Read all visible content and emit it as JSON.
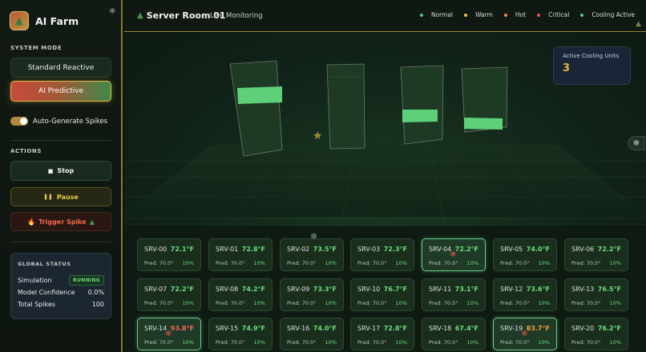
{
  "brand": {
    "name": "AI Farm",
    "logo_icon": "tree-icon"
  },
  "sidebar": {
    "system_mode_label": "SYSTEM MODE",
    "standard_label": "Standard Reactive",
    "ai_label": "AI Predictive",
    "toggle_label": "Auto-Generate Spikes",
    "toggle_on": true,
    "actions_label": "ACTIONS",
    "stop_label": "Stop",
    "pause_label": "Pause",
    "spike_label": "Trigger Spike",
    "global_status": {
      "title": "GLOBAL STATUS",
      "simulation_label": "Simulation",
      "simulation_value": "RUNNING",
      "confidence_label": "Model Confidence",
      "confidence_value": "0.0%",
      "spikes_label": "Total Spikes",
      "spikes_value": "100"
    }
  },
  "header": {
    "title": "Server Room 01",
    "subtitle": "Live Monitoring",
    "legend": [
      {
        "label": "Normal",
        "color": "#4fd07a"
      },
      {
        "label": "Warm",
        "color": "#f0c040"
      },
      {
        "label": "Hot",
        "color": "#f08a3a"
      },
      {
        "label": "Critical",
        "color": "#e85a4a"
      },
      {
        "label": "Cooling Active",
        "color": "#4fd07a"
      }
    ]
  },
  "scene": {
    "cooling_label": "Active Cooling Units",
    "cooling_value": "3"
  },
  "colors": {
    "normal": "#6ddc7a",
    "warm": "#e6e64a",
    "hot": "#f0a040",
    "critical": "#f06a5a",
    "accent": "#e0b84a"
  },
  "servers": [
    {
      "name": "SRV-00",
      "temp": "72.1°F",
      "pred": "Pred: 70.0°",
      "conf": "10%",
      "status": "normal"
    },
    {
      "name": "SRV-01",
      "temp": "72.8°F",
      "pred": "Pred: 70.0°",
      "conf": "10%",
      "status": "normal"
    },
    {
      "name": "SRV-02",
      "temp": "73.5°F",
      "pred": "Pred: 70.0°",
      "conf": "10%",
      "status": "normal"
    },
    {
      "name": "SRV-03",
      "temp": "72.3°F",
      "pred": "Pred: 70.0°",
      "conf": "10%",
      "status": "normal"
    },
    {
      "name": "SRV-04",
      "temp": "72.2°F",
      "pred": "Pred: 70.0°",
      "conf": "10%",
      "status": "normal",
      "highlight": true,
      "cooling": true
    },
    {
      "name": "SRV-05",
      "temp": "74.0°F",
      "pred": "Pred: 70.0°",
      "conf": "10%",
      "status": "normal"
    },
    {
      "name": "SRV-06",
      "temp": "72.2°F",
      "pred": "Pred: 70.0°",
      "conf": "10%",
      "status": "normal"
    },
    {
      "name": "SRV-07",
      "temp": "72.2°F",
      "pred": "Pred: 70.0°",
      "conf": "10%",
      "status": "normal"
    },
    {
      "name": "SRV-08",
      "temp": "74.2°F",
      "pred": "Pred: 70.0°",
      "conf": "10%",
      "status": "normal"
    },
    {
      "name": "SRV-09",
      "temp": "73.3°F",
      "pred": "Pred: 70.0°",
      "conf": "10%",
      "status": "normal"
    },
    {
      "name": "SRV-10",
      "temp": "76.7°F",
      "pred": "Pred: 70.0°",
      "conf": "10%",
      "status": "normal"
    },
    {
      "name": "SRV-11",
      "temp": "73.1°F",
      "pred": "Pred: 70.0°",
      "conf": "10%",
      "status": "normal"
    },
    {
      "name": "SRV-12",
      "temp": "73.6°F",
      "pred": "Pred: 70.0°",
      "conf": "10%",
      "status": "normal"
    },
    {
      "name": "SRV-13",
      "temp": "76.5°F",
      "pred": "Pred: 70.0°",
      "conf": "10%",
      "status": "normal"
    },
    {
      "name": "SRV-14",
      "temp": "93.8°F",
      "pred": "Pred: 70.0°",
      "conf": "10%",
      "status": "critical",
      "highlight": true,
      "cooling": true
    },
    {
      "name": "SRV-15",
      "temp": "74.9°F",
      "pred": "Pred: 70.0°",
      "conf": "10%",
      "status": "normal"
    },
    {
      "name": "SRV-16",
      "temp": "74.0°F",
      "pred": "Pred: 70.0°",
      "conf": "10%",
      "status": "normal"
    },
    {
      "name": "SRV-17",
      "temp": "72.8°F",
      "pred": "Pred: 70.0°",
      "conf": "10%",
      "status": "normal"
    },
    {
      "name": "SRV-18",
      "temp": "67.4°F",
      "pred": "Pred: 70.0°",
      "conf": "10%",
      "status": "normal"
    },
    {
      "name": "SRV-19",
      "temp": "83.7°F",
      "pred": "Pred: 70.0°",
      "conf": "10%",
      "status": "hot",
      "highlight": true,
      "cooling": true
    },
    {
      "name": "SRV-20",
      "temp": "76.2°F",
      "pred": "Pred: 70.0°",
      "conf": "10%",
      "status": "normal"
    }
  ]
}
